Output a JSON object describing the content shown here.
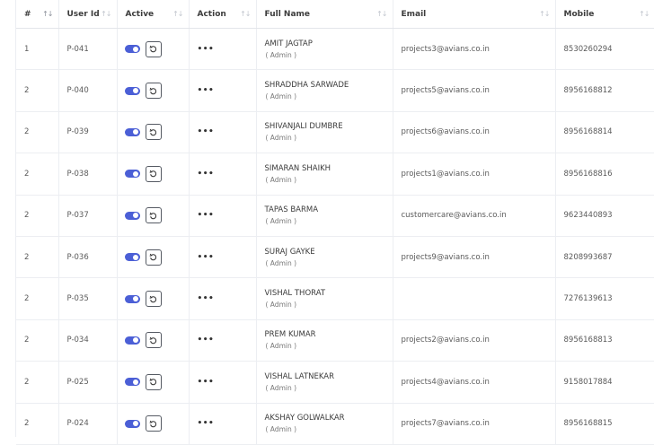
{
  "columns": [
    "#",
    "User Id",
    "Active",
    "Action",
    "Full Name",
    "Email",
    "Mobile"
  ],
  "rows": [
    {
      "num": "1",
      "user_id": "P-041",
      "name": "AMIT JAGTAP",
      "role": "( Admin )",
      "email": "projects3@avians.co.in",
      "mobile": "8530260294"
    },
    {
      "num": "2",
      "user_id": "P-040",
      "name": "SHRADDHA SARWADE",
      "role": "( Admin )",
      "email": "projects5@avians.co.in",
      "mobile": "8956168812"
    },
    {
      "num": "2",
      "user_id": "P-039",
      "name": "SHIVANJALI DUMBRE",
      "role": "( Admin )",
      "email": "projects6@avians.co.in",
      "mobile": "8956168814"
    },
    {
      "num": "2",
      "user_id": "P-038",
      "name": "SIMARAN SHAIKH",
      "role": "( Admin )",
      "email": "projects1@avians.co.in",
      "mobile": "8956168816"
    },
    {
      "num": "2",
      "user_id": "P-037",
      "name": "TAPAS BARMA",
      "role": "( Admin )",
      "email": "customercare@avians.co.in",
      "mobile": "9623440893"
    },
    {
      "num": "2",
      "user_id": "P-036",
      "name": "SURAJ GAYKE",
      "role": "( Admin )",
      "email": "projects9@avians.co.in",
      "mobile": "8208993687"
    },
    {
      "num": "2",
      "user_id": "P-035",
      "name": "VISHAL THORAT",
      "role": "( Admin )",
      "email": "",
      "mobile": "7276139613"
    },
    {
      "num": "2",
      "user_id": "P-034",
      "name": "PREM KUMAR",
      "role": "( Admin )",
      "email": "projects2@avians.co.in",
      "mobile": "8956168813"
    },
    {
      "num": "2",
      "user_id": "P-025",
      "name": "VISHAL LATNEKAR",
      "role": "( Admin )",
      "email": "projects4@avians.co.in",
      "mobile": "9158017884"
    },
    {
      "num": "2",
      "user_id": "P-024",
      "name": "AKSHAY GOLWALKAR",
      "role": "( Admin )",
      "email": "projects7@avians.co.in",
      "mobile": "8956168815"
    }
  ],
  "action_label": "•••",
  "colors": {
    "toggle_on": "#4b5fd6",
    "border": "#eceef2"
  },
  "icons": {
    "sort": "sort-arrows-icon",
    "reset": "reset-icon",
    "toggle": "toggle-switch"
  }
}
